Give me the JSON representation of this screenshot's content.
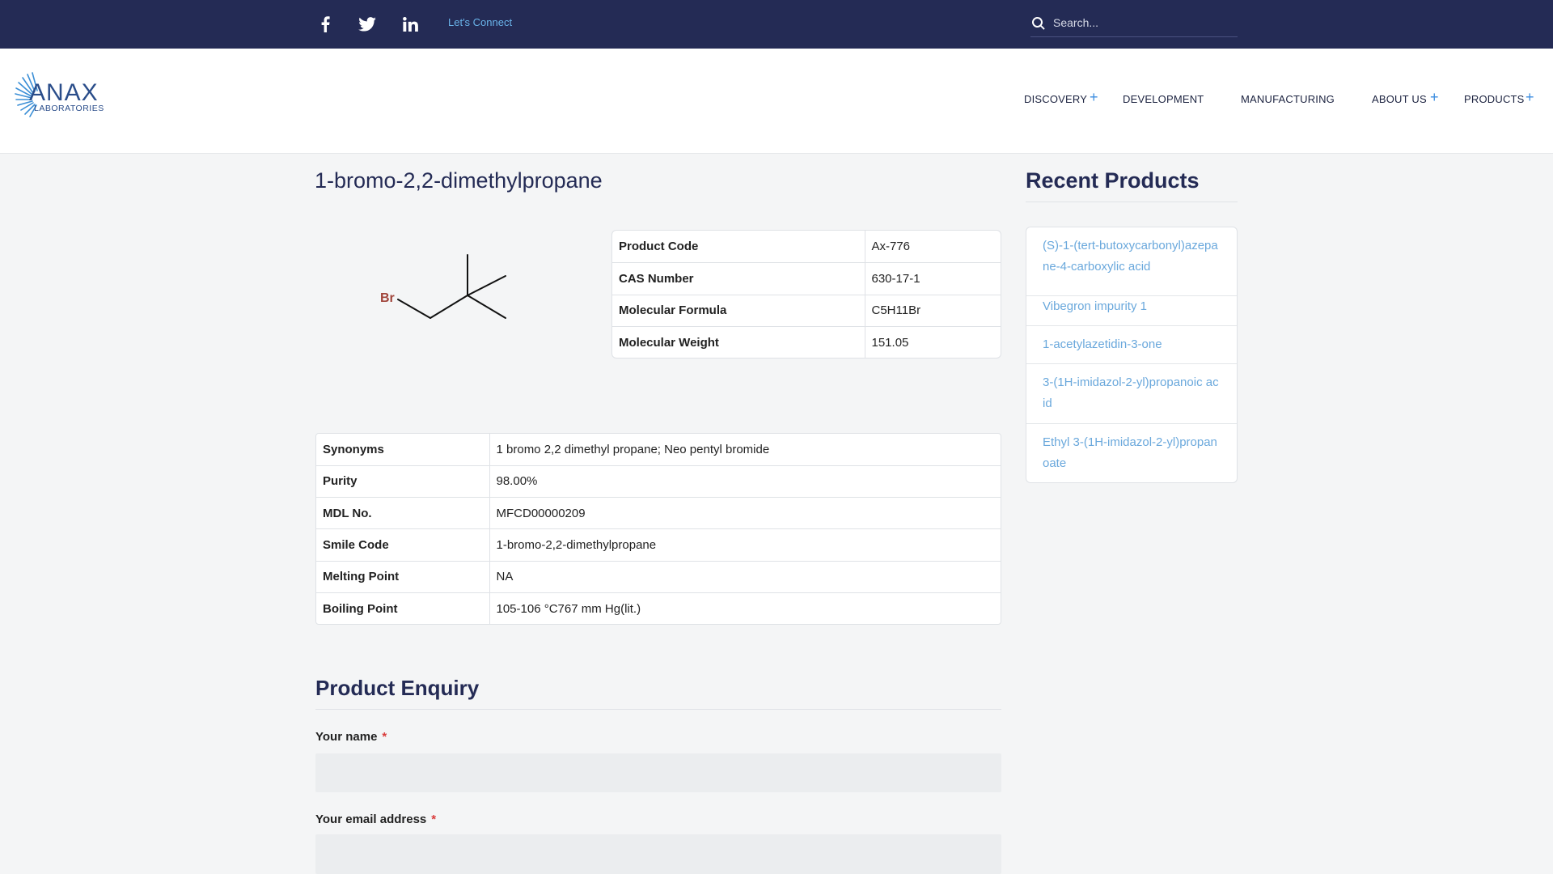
{
  "topbar": {
    "lets_connect": "Let's Connect",
    "search_placeholder": "Search..."
  },
  "logo": {
    "name": "ANAX",
    "subtitle": "LABORATORIES"
  },
  "nav": [
    {
      "label": "DISCOVERY",
      "has_submenu": true
    },
    {
      "label": "DEVELOPMENT",
      "has_submenu": false
    },
    {
      "label": "MANUFACTURING",
      "has_submenu": false
    },
    {
      "label": "ABOUT US",
      "has_submenu": true
    },
    {
      "label": "PRODUCTS",
      "has_submenu": true
    }
  ],
  "product": {
    "title": "1-bromo-2,2-dimethylpropane",
    "structure_atom_label": "Br",
    "basic": [
      {
        "key": "Product Code",
        "value": "Ax-776"
      },
      {
        "key": "CAS Number",
        "value": "630-17-1"
      },
      {
        "key": "Molecular Formula",
        "value": "C5H11Br"
      },
      {
        "key": "Molecular Weight",
        "value": "151.05"
      }
    ],
    "details": [
      {
        "key": "Synonyms",
        "value": "1 bromo 2,2 dimethyl propane; Neo pentyl bromide"
      },
      {
        "key": "Purity",
        "value": "98.00%"
      },
      {
        "key": "MDL No.",
        "value": "MFCD00000209"
      },
      {
        "key": "Smile Code",
        "value": "1-bromo-2,2-dimethylpropane"
      },
      {
        "key": "Melting Point",
        "value": "NA"
      },
      {
        "key": "Boiling Point",
        "value": "105-106 °C767 mm Hg(lit.)"
      }
    ]
  },
  "enquiry": {
    "title": "Product Enquiry",
    "name_label": "Your name",
    "email_label": "Your email address",
    "required_mark": "*"
  },
  "sidebar": {
    "title": "Recent Products",
    "items": [
      "(S)-1-(tert-butoxycarbonyl)azepane-4-carboxylic acid",
      "Vibegron impurity 1",
      "1-acetylazetidin-3-one",
      "3-(1H-imidazol-2-yl)propanoic acid",
      "Ethyl 3-(1H-imidazol-2-yl)propanoate"
    ]
  },
  "colors": {
    "topbar_bg": "#242b55",
    "accent": "#3d8ee0",
    "link": "#6aa8dc",
    "heading": "#242b55",
    "required": "#d93b3b"
  }
}
